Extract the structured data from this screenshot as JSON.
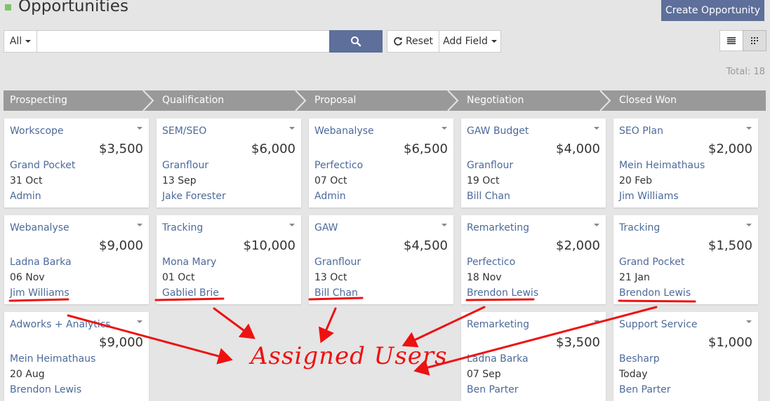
{
  "header": {
    "title": "Opportunities",
    "create_label": "Create Opportunity"
  },
  "toolbar": {
    "filter_label": "All",
    "search_value": "",
    "reset_label": "Reset",
    "add_field_label": "Add Field",
    "total_label": "Total: 18"
  },
  "stages": [
    "Prospecting",
    "Qualification",
    "Proposal",
    "Negotiation",
    "Closed Won"
  ],
  "cards": [
    {
      "name": "Workscope",
      "amount": "$3,500",
      "account": "Grand Pocket",
      "date": "31 Oct",
      "user": "Admin"
    },
    {
      "name": "SEM/SEO",
      "amount": "$6,000",
      "account": "Granflour",
      "date": "13 Sep",
      "user": "Jake Forester"
    },
    {
      "name": "Webanalyse",
      "amount": "$6,500",
      "account": "Perfectico",
      "date": "07 Oct",
      "user": "Admin"
    },
    {
      "name": "GAW Budget",
      "amount": "$4,000",
      "account": "Granflour",
      "date": "19 Oct",
      "user": "Bill Chan"
    },
    {
      "name": "SEO Plan",
      "amount": "$2,000",
      "account": "Mein Heimathaus",
      "date": "20 Feb",
      "user": "Jim Williams"
    },
    {
      "name": "Webanalyse",
      "amount": "$9,000",
      "account": "Ladna Barka",
      "date": "06 Nov",
      "user": "Jim Williams"
    },
    {
      "name": "Tracking",
      "amount": "$10,000",
      "account": "Mona Mary",
      "date": "01 Oct",
      "user": "Gabliel Brie"
    },
    {
      "name": "GAW",
      "amount": "$4,500",
      "account": "Granflour",
      "date": "13 Oct",
      "user": "Bill Chan"
    },
    {
      "name": "Remarketing",
      "amount": "$2,000",
      "account": "Perfectico",
      "date": "18 Nov",
      "user": "Brendon Lewis"
    },
    {
      "name": "Tracking",
      "amount": "$1,500",
      "account": "Grand Pocket",
      "date": "21 Jan",
      "user": "Brendon Lewis"
    },
    {
      "name": "Adworks + Analytics",
      "amount": "$9,000",
      "account": "Mein Heimathaus",
      "date": "20 Aug",
      "user": "Brendon Lewis"
    },
    {
      "name": "Remarketing",
      "amount": "$3,500",
      "account": "Ladna Barka",
      "date": "07 Sep",
      "user": "Ben Parter"
    },
    {
      "name": "Support Service",
      "amount": "$1,000",
      "account": "Besharp",
      "date": "Today",
      "user": "Ben Parter"
    }
  ],
  "annotation": {
    "label": "Assigned Users",
    "color": "#ee1111"
  }
}
